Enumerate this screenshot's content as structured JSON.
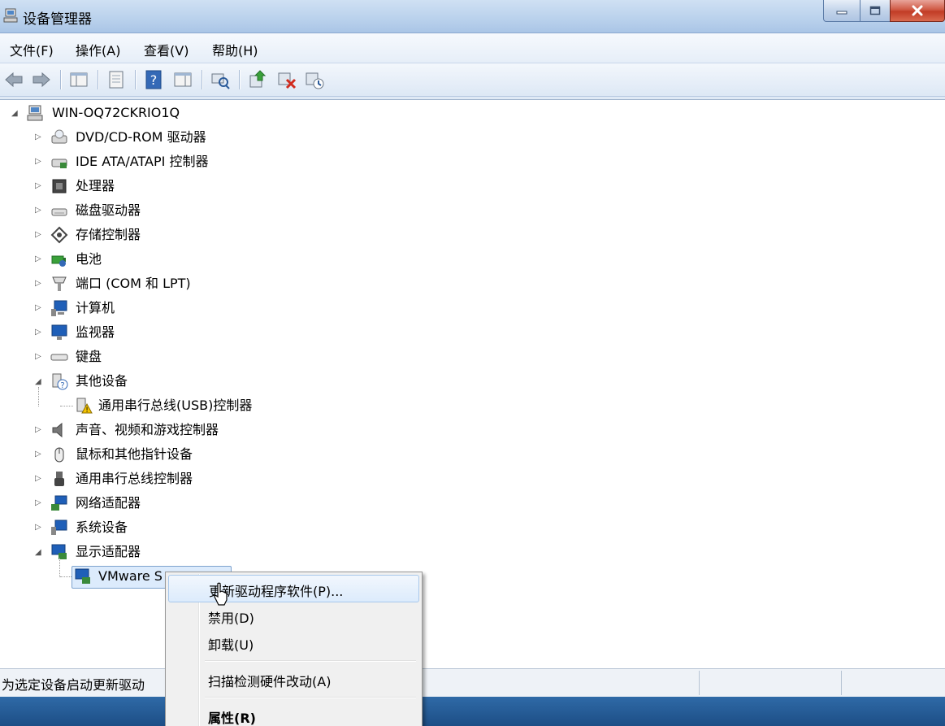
{
  "window": {
    "title": "设备管理器",
    "controls": {
      "minimize_icon": "minimize-icon",
      "maximize_icon": "maximize-icon",
      "close_icon": "close-icon"
    }
  },
  "menubar": {
    "items": [
      {
        "label": "文件(F)"
      },
      {
        "label": "操作(A)"
      },
      {
        "label": "查看(V)"
      },
      {
        "label": "帮助(H)"
      }
    ]
  },
  "toolbar": {
    "buttons": [
      "back-icon",
      "forward-icon",
      "show-hide-console-tree-icon",
      "properties-icon",
      "help-icon",
      "action-pane-icon",
      "scan-hardware-icon",
      "update-driver-icon",
      "uninstall-icon",
      "disable-icon"
    ]
  },
  "tree": {
    "root": {
      "label": "WIN-OQ72CKRIO1Q",
      "icon": "computer-icon"
    },
    "categories": [
      {
        "label": "DVD/CD-ROM 驱动器",
        "icon": "dvd-drive-icon",
        "expanded": false
      },
      {
        "label": "IDE ATA/ATAPI 控制器",
        "icon": "ide-controller-icon",
        "expanded": false
      },
      {
        "label": "处理器",
        "icon": "processor-icon",
        "expanded": false
      },
      {
        "label": "磁盘驱动器",
        "icon": "disk-drive-icon",
        "expanded": false
      },
      {
        "label": "存储控制器",
        "icon": "storage-controller-icon",
        "expanded": false
      },
      {
        "label": "电池",
        "icon": "battery-icon",
        "expanded": false
      },
      {
        "label": "端口 (COM 和 LPT)",
        "icon": "port-icon",
        "expanded": false
      },
      {
        "label": "计算机",
        "icon": "computer-category-icon",
        "expanded": false
      },
      {
        "label": "监视器",
        "icon": "monitor-icon",
        "expanded": false
      },
      {
        "label": "键盘",
        "icon": "keyboard-icon",
        "expanded": false
      },
      {
        "label": "其他设备",
        "icon": "other-devices-icon",
        "expanded": true,
        "children": [
          {
            "label": "通用串行总线(USB)控制器",
            "icon": "warning-device-icon"
          }
        ]
      },
      {
        "label": "声音、视频和游戏控制器",
        "icon": "sound-icon",
        "expanded": false
      },
      {
        "label": "鼠标和其他指针设备",
        "icon": "mouse-icon",
        "expanded": false
      },
      {
        "label": "通用串行总线控制器",
        "icon": "usb-icon",
        "expanded": false
      },
      {
        "label": "网络适配器",
        "icon": "network-adapter-icon",
        "expanded": false
      },
      {
        "label": "系统设备",
        "icon": "system-devices-icon",
        "expanded": false
      },
      {
        "label": "显示适配器",
        "icon": "display-adapter-icon",
        "expanded": true,
        "children": [
          {
            "label": "VMware S",
            "icon": "display-device-icon",
            "selected": true
          }
        ]
      }
    ]
  },
  "context_menu": {
    "items": [
      {
        "label": "更新驱动程序软件(P)...",
        "highlighted": true
      },
      {
        "label": "禁用(D)"
      },
      {
        "label": "卸载(U)"
      },
      {
        "separator": true
      },
      {
        "label": "扫描检测硬件改动(A)"
      },
      {
        "separator": true
      },
      {
        "label": "属性(R)",
        "bold": true
      }
    ]
  },
  "statusbar": {
    "text": "为选定设备启动更新驱动"
  },
  "colors": {
    "selection": "#dcebfc",
    "selection_border": "#7da2ce",
    "titlebar": "#b9d1ec",
    "close_button": "#c13c26"
  }
}
